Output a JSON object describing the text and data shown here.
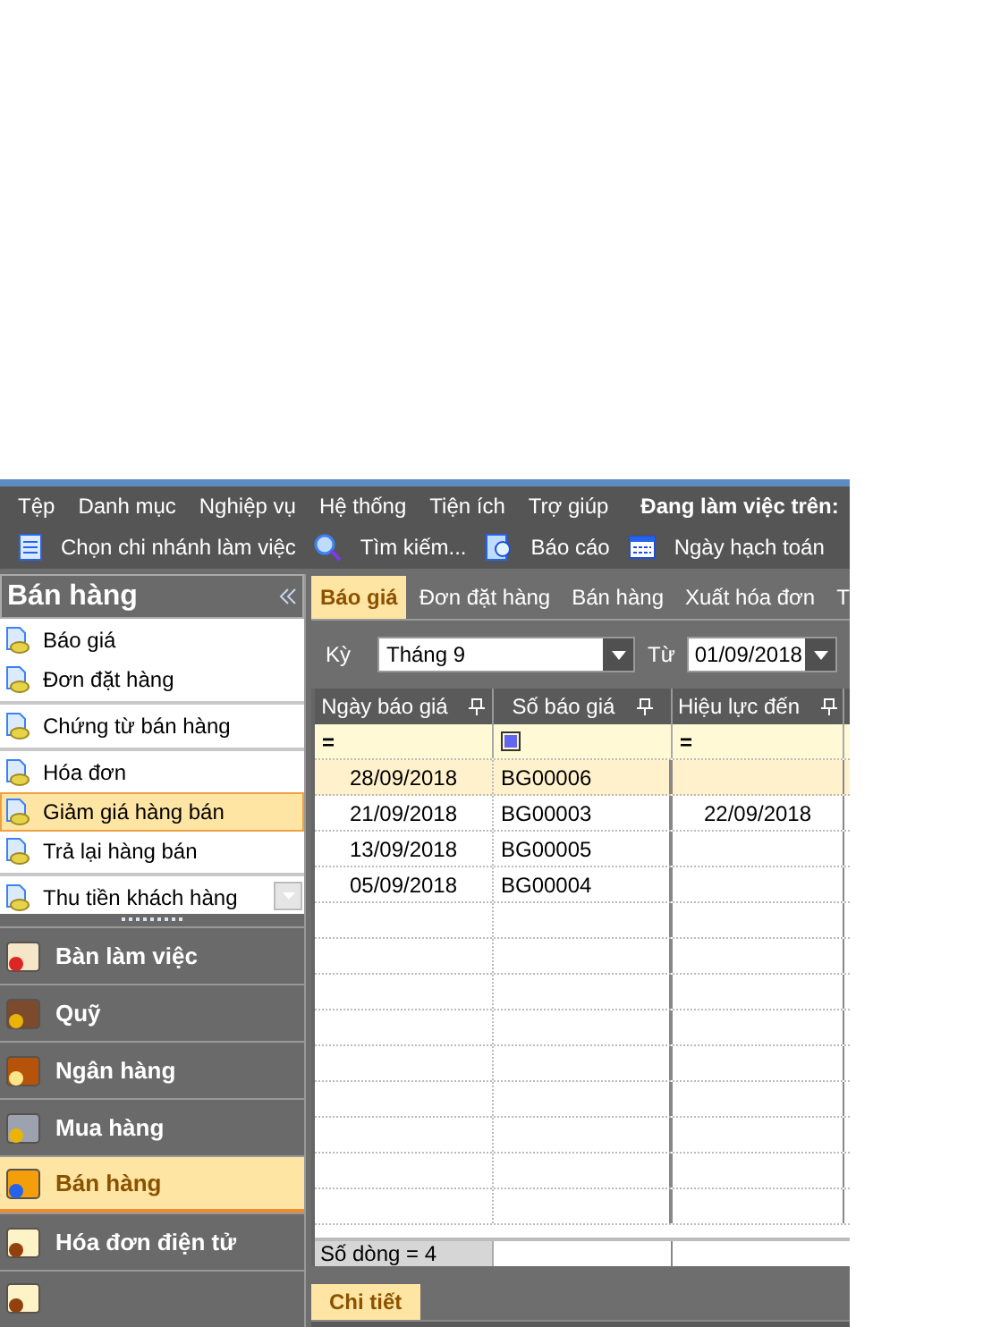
{
  "menu": [
    "Tệp",
    "Danh mục",
    "Nghiệp vụ",
    "Hệ thống",
    "Tiện ích",
    "Trợ giúp"
  ],
  "workspace_label": "Đang làm việc trên:",
  "toolbar": [
    {
      "label": "Chọn chi nhánh làm việc",
      "kind": "document"
    },
    {
      "label": "Tìm kiếm...",
      "kind": "search"
    },
    {
      "label": "Báo cáo",
      "kind": "report"
    },
    {
      "label": "Ngày hạch toán",
      "kind": "calendar"
    }
  ],
  "sidebar": {
    "title": "Bán hàng",
    "groups": [
      [
        {
          "label": "Báo giá",
          "selected": false
        },
        {
          "label": "Đơn đặt hàng",
          "selected": false
        }
      ],
      [
        {
          "label": "Chứng từ bán hàng",
          "selected": false
        }
      ],
      [
        {
          "label": "Hóa đơn",
          "selected": false
        },
        {
          "label": "Giảm giá hàng bán",
          "selected": true
        },
        {
          "label": "Trả lại hàng bán",
          "selected": false
        }
      ],
      [
        {
          "label": "Thu tiền khách hàng",
          "selected": false
        }
      ]
    ],
    "modules": [
      {
        "label": "Bàn làm việc",
        "kind": "desk",
        "selected": false
      },
      {
        "label": "Quỹ",
        "kind": "safe",
        "selected": false
      },
      {
        "label": "Ngân hàng",
        "kind": "bank",
        "selected": false
      },
      {
        "label": "Mua hàng",
        "kind": "cart",
        "selected": false
      },
      {
        "label": "Bán hàng",
        "kind": "sale",
        "selected": true
      },
      {
        "label": "Hóa đơn điện tử",
        "kind": "invoice",
        "selected": false
      }
    ]
  },
  "tabs": [
    {
      "label": "Báo giá",
      "selected": true
    },
    {
      "label": "Đơn đặt hàng",
      "selected": false
    },
    {
      "label": "Bán hàng",
      "selected": false
    },
    {
      "label": "Xuất hóa đơn",
      "selected": false
    },
    {
      "label": "T",
      "selected": false
    }
  ],
  "filter": {
    "period_label": "Kỳ",
    "period": "Tháng 9",
    "from_label": "Từ",
    "from": "01/09/2018"
  },
  "table": {
    "columns": [
      "Ngày báo giá",
      "Số báo giá",
      "Hiệu lực đến"
    ],
    "filter_row": [
      {
        "kind": "equals",
        "text": "="
      },
      {
        "kind": "checkbox",
        "checked": true
      },
      {
        "kind": "equals",
        "text": "="
      }
    ],
    "rows": [
      {
        "cells": [
          "28/09/2018",
          "BG00006",
          ""
        ],
        "selected": true
      },
      {
        "cells": [
          "21/09/2018",
          "BG00003",
          "22/09/2018"
        ],
        "selected": false
      },
      {
        "cells": [
          "13/09/2018",
          "BG00005",
          ""
        ],
        "selected": false
      },
      {
        "cells": [
          "05/09/2018",
          "BG00004",
          ""
        ],
        "selected": false
      }
    ],
    "footer": "Số dòng = 4"
  },
  "detail_tab": {
    "label": "Chi tiết",
    "selected": true
  }
}
